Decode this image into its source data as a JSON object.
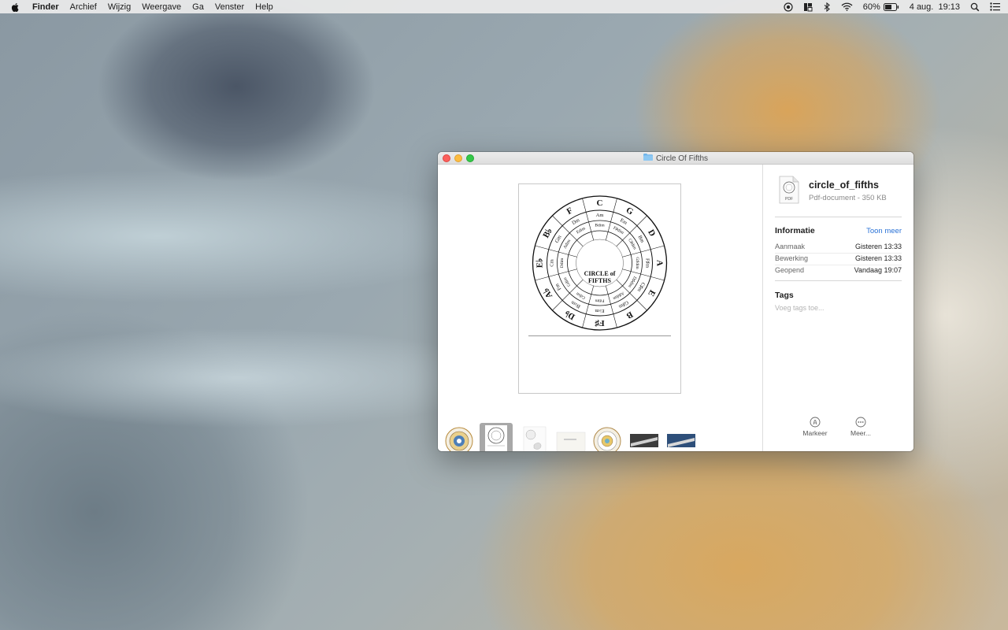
{
  "menubar": {
    "apple_icon": "apple-logo",
    "items": [
      "Finder",
      "Archief",
      "Wijzig",
      "Weergave",
      "Ga",
      "Venster",
      "Help"
    ],
    "status": {
      "battery_percent": "60%",
      "clock": "4 aug.  19:13"
    }
  },
  "window": {
    "title": "Circle Of Fifths",
    "title_icon": "folder-icon"
  },
  "preview": {
    "circle_title_line1": "CIRCLE of",
    "circle_title_line2": "FIFTHS",
    "outer_keys": [
      "C",
      "G",
      "D",
      "A",
      "E",
      "B",
      "F♯",
      "D♭",
      "A♭",
      "E♭",
      "B♭",
      "F"
    ],
    "minor_keys": [
      "Am",
      "Em",
      "Bm",
      "F♯m",
      "C♯m",
      "G♯m",
      "E♭m",
      "B♭m",
      "Fm",
      "Cm",
      "Gm",
      "Dm"
    ],
    "dim_chords": [
      "Bdim",
      "F♯dim",
      "C♯dim",
      "G♯dim",
      "D♯dim",
      "A♯dim",
      "Fdim",
      "Cdim",
      "Gdim",
      "Ddim",
      "Adim",
      "Edim"
    ]
  },
  "thumbnails": {
    "count": 7,
    "selected_index": 1
  },
  "info_panel": {
    "file_name": "circle_of_fifths",
    "file_type": "Pdf-document - 350 KB",
    "file_icon_label": "PDF",
    "info_heading": "Informatie",
    "show_more": "Toon meer",
    "rows": [
      {
        "label": "Aanmaak",
        "value": "Gisteren 13:33"
      },
      {
        "label": "Bewerking",
        "value": "Gisteren 13:33"
      },
      {
        "label": "Geopend",
        "value": "Vandaag 19:07"
      }
    ],
    "tags_heading": "Tags",
    "tags_placeholder": "Voeg tags toe...",
    "actions": [
      {
        "label": "Markeer",
        "icon": "markup-icon"
      },
      {
        "label": "Meer...",
        "icon": "more-icon"
      }
    ]
  }
}
